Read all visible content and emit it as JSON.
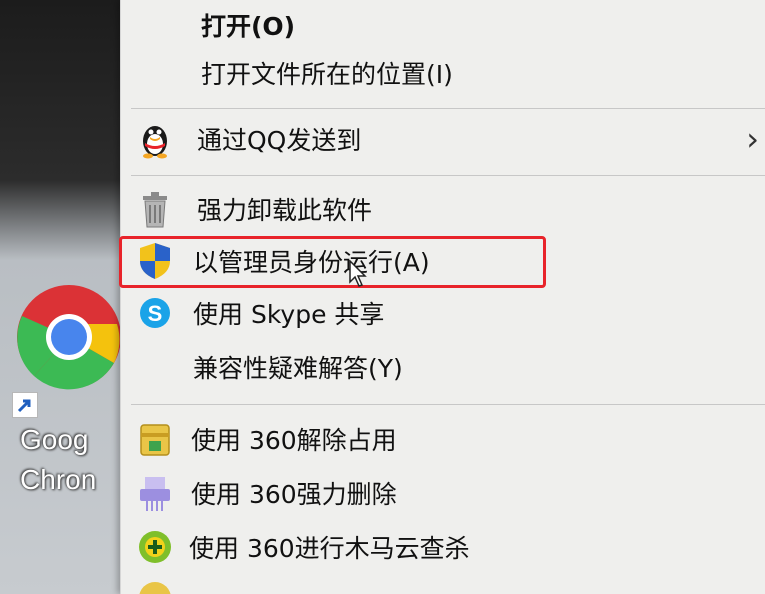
{
  "desktop": {
    "top_text": "",
    "icon_label_line1": "Goog",
    "icon_label_line2": "Chron"
  },
  "context_menu": {
    "items": [
      {
        "id": "open",
        "label": "打开(O)",
        "bold": true,
        "icon": null
      },
      {
        "id": "open-location",
        "label": "打开文件所在的位置(I)",
        "icon": null
      },
      {
        "id": "send-qq",
        "label": "通过QQ发送到",
        "icon": "qq-penguin-icon",
        "submenu": true
      },
      {
        "id": "uninstall",
        "label": "强力卸载此软件",
        "icon": "trash-icon"
      },
      {
        "id": "run-as-admin",
        "label": "以管理员身份运行(A)",
        "icon": "uac-shield-icon",
        "highlighted": true
      },
      {
        "id": "skype-share",
        "label": "使用 Skype 共享",
        "icon": "skype-icon"
      },
      {
        "id": "troubleshoot",
        "label": "兼容性疑难解答(Y)",
        "icon": null
      },
      {
        "id": "unlock-360",
        "label": "使用 360解除占用",
        "icon": "360-unlock-icon"
      },
      {
        "id": "delete-360",
        "label": "使用 360强力删除",
        "icon": "360-shred-icon"
      },
      {
        "id": "scan-360",
        "label": "使用 360进行木马云查杀",
        "icon": "360-scan-icon"
      }
    ],
    "submenu_glyph": "›"
  },
  "colors": {
    "highlight_border": "#e8232a",
    "menu_background": "#efefed",
    "shield_blue": "#2a62c9",
    "shield_yellow": "#f2c21b",
    "skype_blue": "#1aa3e8",
    "scan_green": "#7fbf2a"
  }
}
